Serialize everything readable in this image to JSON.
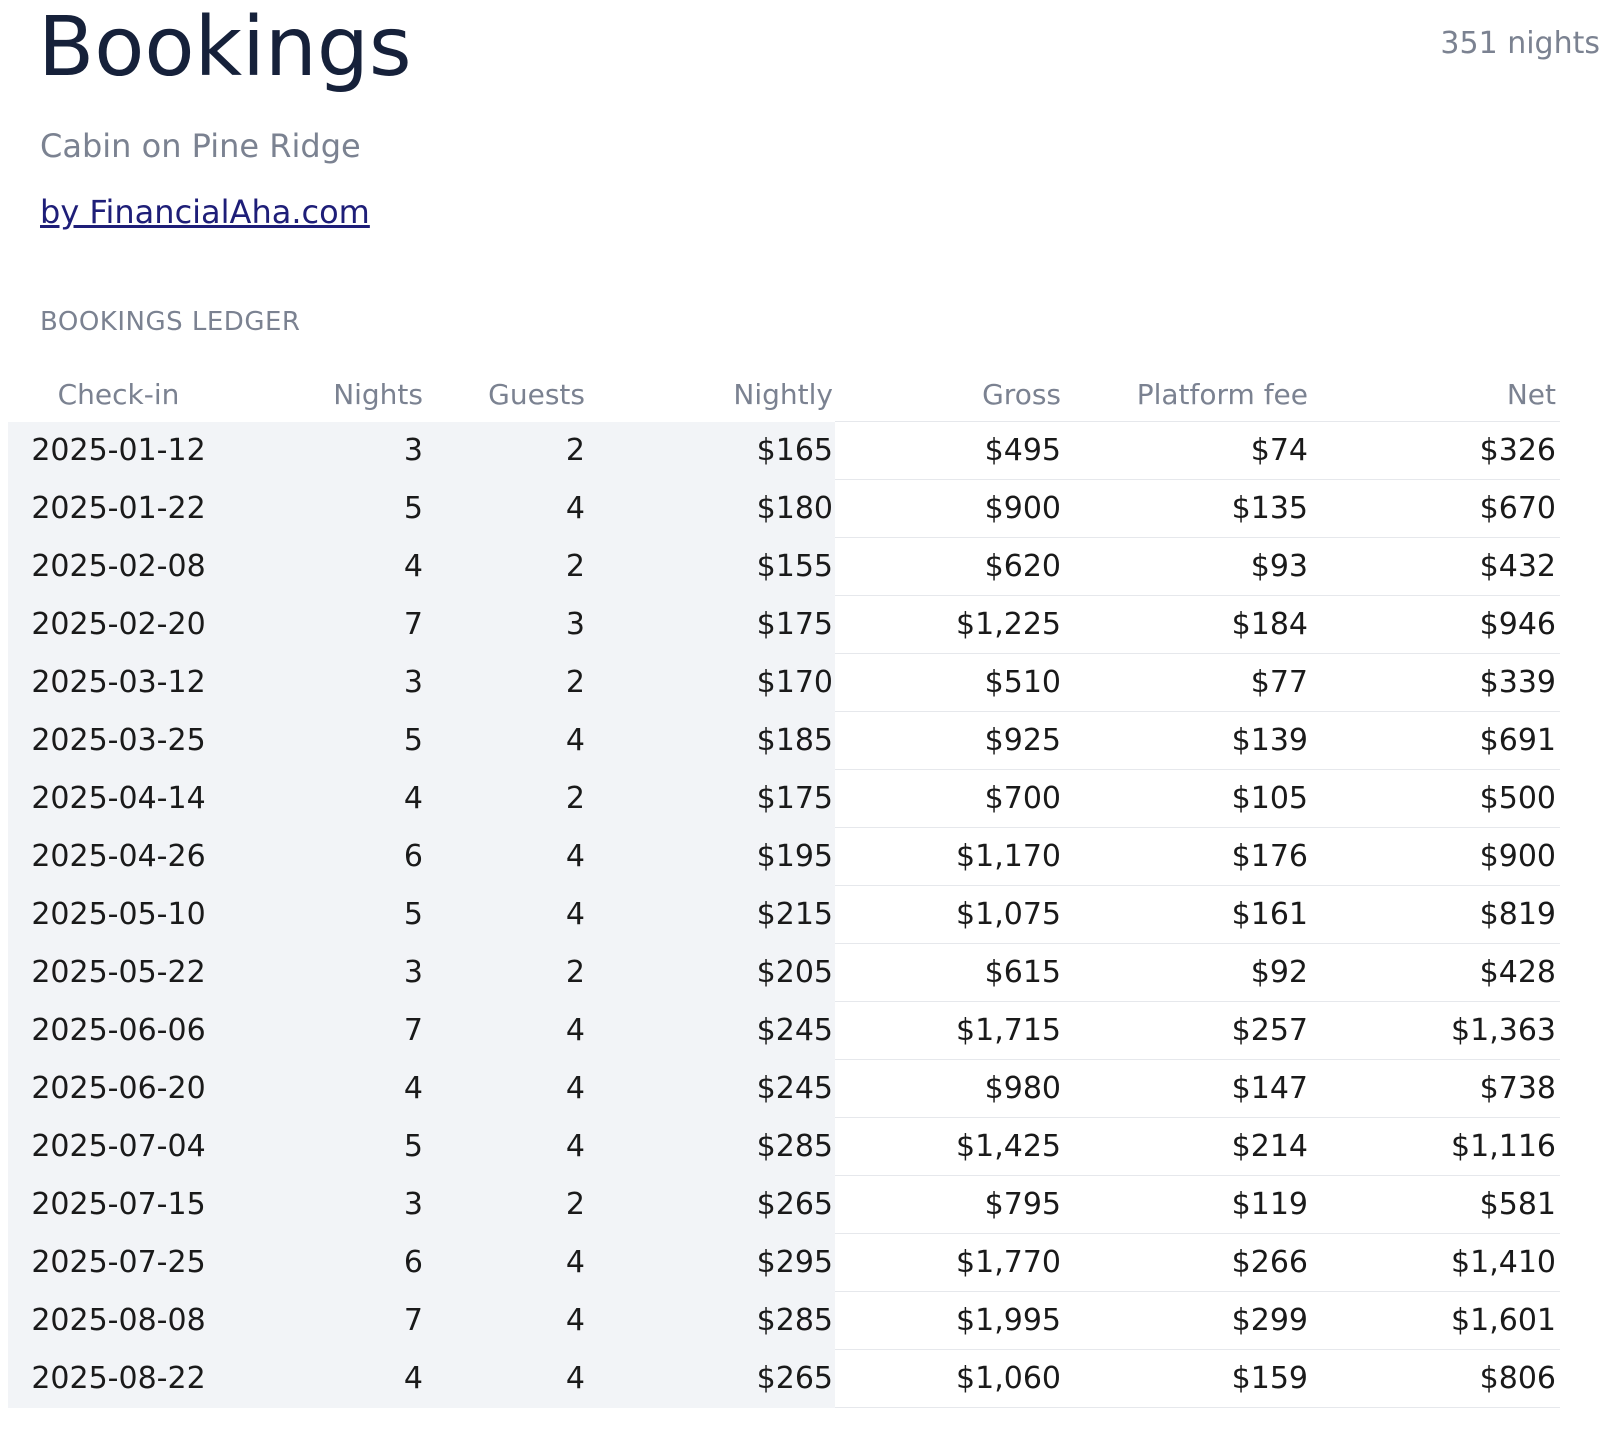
{
  "header": {
    "title": "Bookings",
    "nights_total": "351 nights",
    "subtitle": "Cabin on Pine Ridge",
    "credit_link": "by FinancialAha.com"
  },
  "ledger": {
    "section_label": "BOOKINGS LEDGER",
    "columns": [
      "Check-in",
      "Nights",
      "Guests",
      "Nightly",
      "Gross",
      "Platform fee",
      "Net"
    ],
    "rows": [
      [
        "2025-01-12",
        "3",
        "2",
        "$165",
        "$495",
        "$74",
        "$326"
      ],
      [
        "2025-01-22",
        "5",
        "4",
        "$180",
        "$900",
        "$135",
        "$670"
      ],
      [
        "2025-02-08",
        "4",
        "2",
        "$155",
        "$620",
        "$93",
        "$432"
      ],
      [
        "2025-02-20",
        "7",
        "3",
        "$175",
        "$1,225",
        "$184",
        "$946"
      ],
      [
        "2025-03-12",
        "3",
        "2",
        "$170",
        "$510",
        "$77",
        "$339"
      ],
      [
        "2025-03-25",
        "5",
        "4",
        "$185",
        "$925",
        "$139",
        "$691"
      ],
      [
        "2025-04-14",
        "4",
        "2",
        "$175",
        "$700",
        "$105",
        "$500"
      ],
      [
        "2025-04-26",
        "6",
        "4",
        "$195",
        "$1,170",
        "$176",
        "$900"
      ],
      [
        "2025-05-10",
        "5",
        "4",
        "$215",
        "$1,075",
        "$161",
        "$819"
      ],
      [
        "2025-05-22",
        "3",
        "2",
        "$205",
        "$615",
        "$92",
        "$428"
      ],
      [
        "2025-06-06",
        "7",
        "4",
        "$245",
        "$1,715",
        "$257",
        "$1,363"
      ],
      [
        "2025-06-20",
        "4",
        "4",
        "$245",
        "$980",
        "$147",
        "$738"
      ],
      [
        "2025-07-04",
        "5",
        "4",
        "$285",
        "$1,425",
        "$214",
        "$1,116"
      ],
      [
        "2025-07-15",
        "3",
        "2",
        "$265",
        "$795",
        "$119",
        "$581"
      ],
      [
        "2025-07-25",
        "6",
        "4",
        "$295",
        "$1,770",
        "$266",
        "$1,410"
      ],
      [
        "2025-08-08",
        "7",
        "4",
        "$285",
        "$1,995",
        "$299",
        "$1,601"
      ],
      [
        "2025-08-22",
        "4",
        "4",
        "$265",
        "$1,060",
        "$159",
        "$806"
      ]
    ]
  }
}
